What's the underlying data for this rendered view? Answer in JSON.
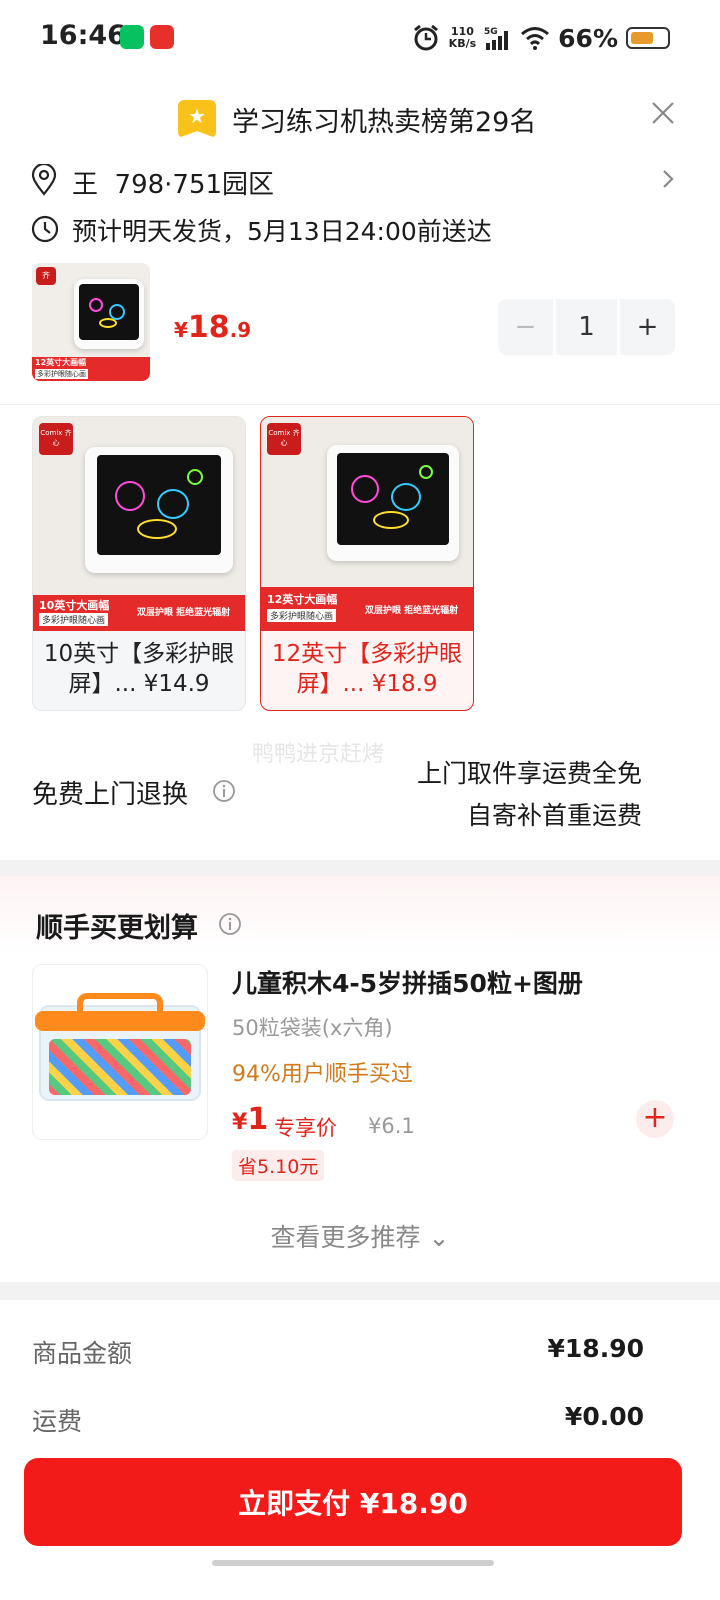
{
  "status_bar": {
    "time": "16:46",
    "net_speed_value": "110",
    "net_speed_unit": "KB/s",
    "network": "5G",
    "battery_percent": "66%",
    "battery_level": 0.66
  },
  "header": {
    "rank_text": "学习练习机热卖榜第29名"
  },
  "address": {
    "text": "王  798·751园区"
  },
  "delivery": {
    "text": "预计明天发货，5月13日24:00前送达"
  },
  "selected": {
    "price_currency": "¥",
    "price_int": "18",
    "price_dec": ".9",
    "quantity": "1",
    "thumb_tag": "12英寸大画幅",
    "thumb_sub": "多彩护眼随心画"
  },
  "variants": [
    {
      "label": "10英寸【多彩护眼屏】... ¥14.9",
      "banner_title": "10英寸大画幅",
      "banner_sub": "多彩护眼随心画",
      "banner_right": "双层护眼 拒绝蓝光辐射",
      "brand": "Comix 齐心"
    },
    {
      "label": "12英寸【多彩护眼屏】... ¥18.9",
      "banner_title": "12英寸大画幅",
      "banner_sub": "多彩护眼随心画",
      "banner_right": "双层护眼 拒绝蓝光辐射",
      "brand": "Comix 齐心"
    }
  ],
  "watermark": "鸭鸭进京赶烤",
  "returns": {
    "title": "免费上门退换",
    "line1": "上门取件享运费全免",
    "line2": "自寄补首重运费"
  },
  "recommendation": {
    "title": "顺手买更划算",
    "item": {
      "name": "儿童积木4-5岁拼插50粒+图册",
      "spec": "50粒袋装(x六角)",
      "tag": "94%用户顺手买过",
      "price_currency": "¥",
      "price": "1",
      "price_label": "专享价",
      "original_price": "¥6.1",
      "saving": "省5.10元"
    },
    "more": "查看更多推荐 ⌄"
  },
  "summary": {
    "goods_label": "商品金额",
    "goods_value": "¥18.90",
    "shipping_label": "运费",
    "shipping_value": "¥0.00"
  },
  "pay_button": "立即支付 ¥18.90",
  "colors": {
    "accent_red": "#e1251b",
    "pay_button": "#f31a1a",
    "tag_orange": "#d27a1a",
    "rank_badge": "#f9c21a"
  },
  "icons": [
    "location-pin-icon",
    "clock-icon",
    "close-icon",
    "chevron-right-icon",
    "info-icon",
    "plus-icon",
    "minus-icon",
    "star-badge-icon",
    "wifi-icon",
    "signal-icon",
    "alarm-icon",
    "battery-icon"
  ]
}
